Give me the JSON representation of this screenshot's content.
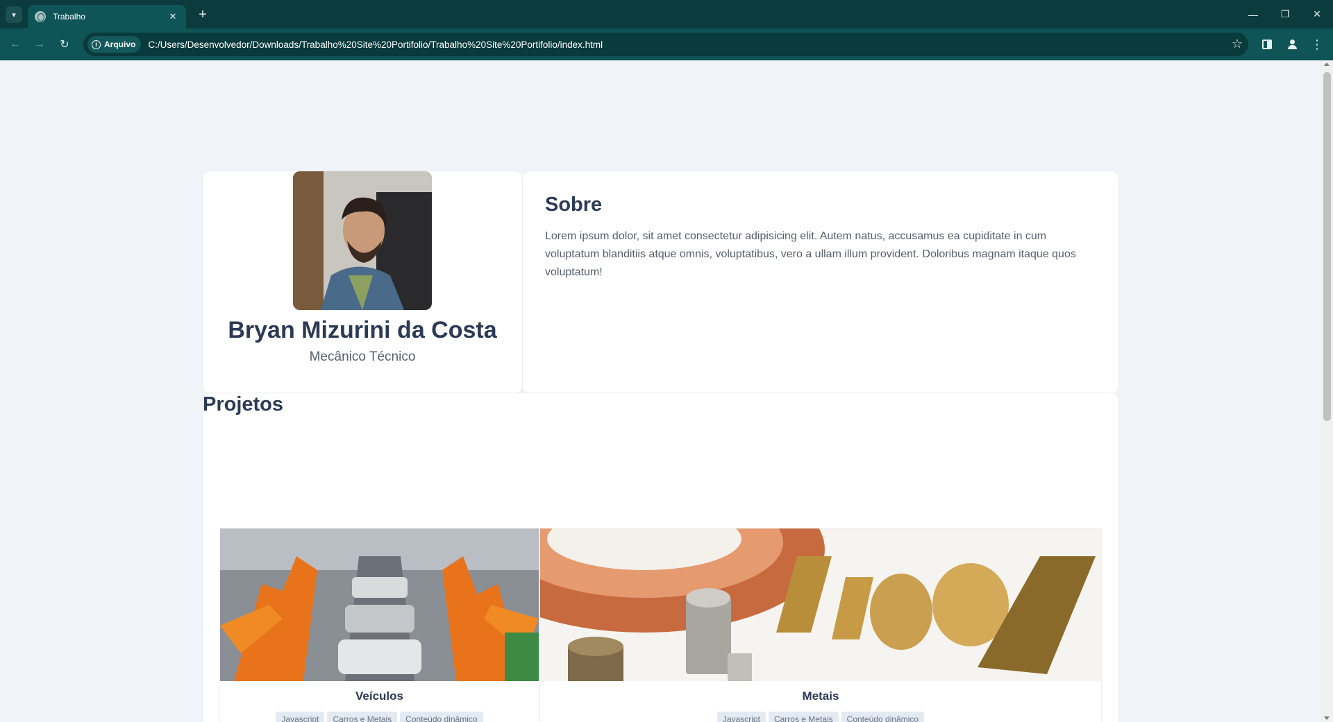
{
  "browser": {
    "tab": {
      "title": "Trabalho",
      "close": "✕"
    },
    "new_tab": "+",
    "window_controls": {
      "minimize": "—",
      "restore": "❐",
      "close": "✕"
    },
    "nav": {
      "back": "←",
      "forward": "→",
      "reload": "↻"
    },
    "site_chip": "Arquivo",
    "url": "C:/Users/Desenvolvedor/Downloads/Trabalho%20Site%20Portifolio/Trabalho%20Site%20Portifolio/index.html",
    "menu": "⋮",
    "star": "☆"
  },
  "profile": {
    "name": "Bryan Mizurini da Costa",
    "role": "Mecânico Técnico"
  },
  "about": {
    "title": "Sobre",
    "text": "Lorem ipsum dolor, sit amet consectetur adipisicing elit. Autem natus, accusamus ea cupiditate in cum voluptatum blanditiis atque omnis, voluptatibus, vero a ullam illum provident. Doloribus magnam itaque quos voluptatum!"
  },
  "projects": {
    "title": "Projetos",
    "items": [
      {
        "title": "Veículos",
        "tags": [
          "Javascript",
          "Carros e Metais",
          "Conteúdo dinâmico"
        ]
      },
      {
        "title": "Metais",
        "tags": [
          "Javascript",
          "Carros e Metais",
          "Conteúdo dinâmico"
        ]
      }
    ]
  },
  "colors": {
    "chrome": "#0b3b3d",
    "toolbar": "#0f5557",
    "heading": "#2c3a55",
    "page_bg": "#f0f3f7"
  }
}
